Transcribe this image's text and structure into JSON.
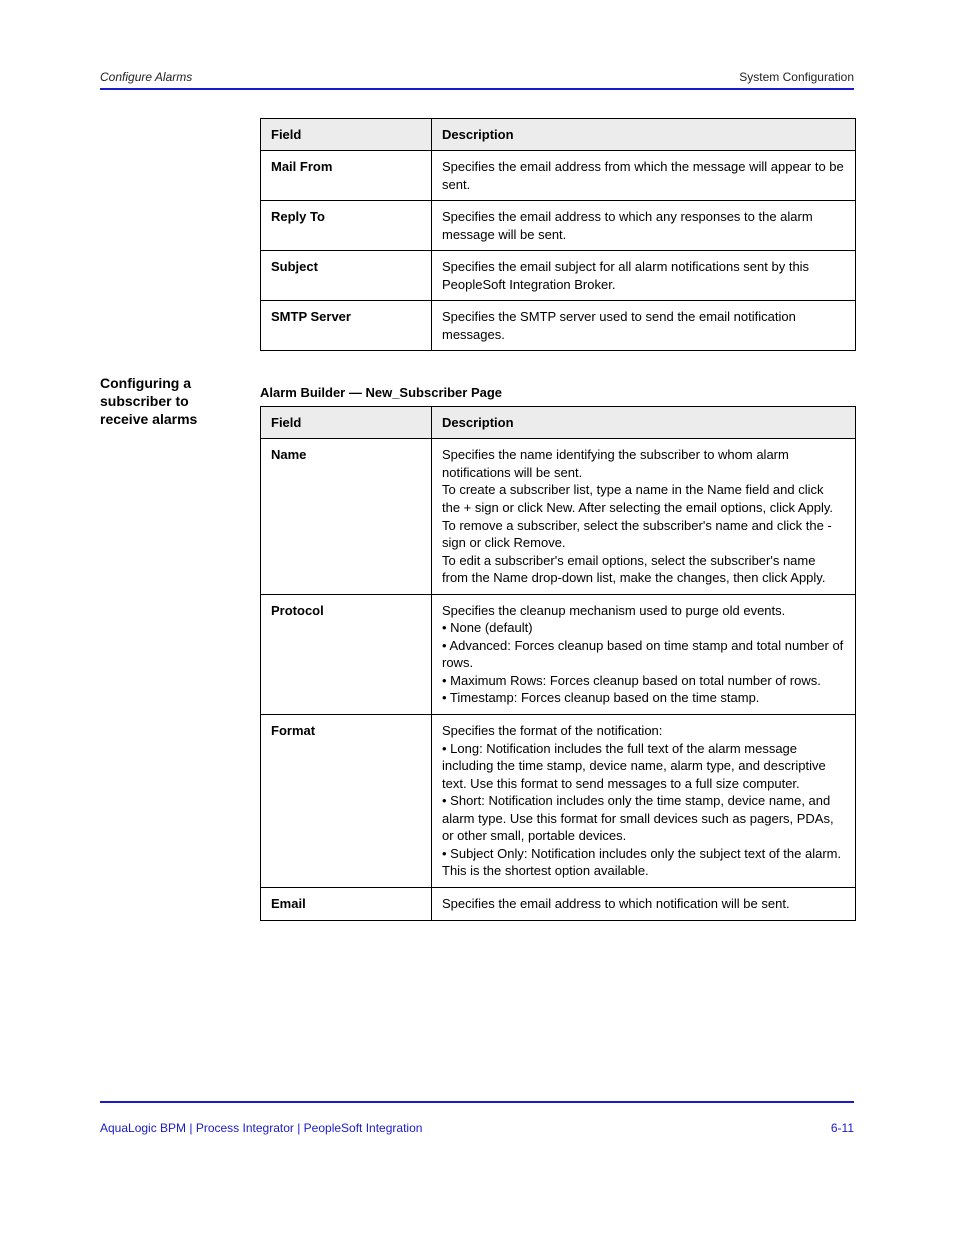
{
  "header": {
    "left": "Configure Alarms",
    "right": "System Configuration"
  },
  "table1": {
    "headers": [
      "Field",
      "Description"
    ],
    "rows": [
      [
        "Mail From",
        "Specifies the email address from which the message will appear to be sent."
      ],
      [
        "Reply To",
        "Specifies the email address to which any responses to the alarm message will be sent."
      ],
      [
        "Subject",
        "Specifies the email subject for all alarm notifications sent by this PeopleSoft Integration Broker."
      ],
      [
        "SMTP Server",
        "Specifies the SMTP server used to send the email notification messages."
      ]
    ]
  },
  "table2": {
    "caption": "Alarm Builder — New_Subscriber Page",
    "headers": [
      "Field",
      "Description"
    ],
    "rows": [
      [
        "Name",
        "Specifies the name identifying the subscriber to whom alarm notifications will be sent.\nTo create a subscriber list, type a name in the Name field and click the + sign or click New. After selecting the email options, click Apply.\nTo remove a subscriber, select the subscriber's name and click the - sign or click Remove.\nTo edit a subscriber's email options, select the subscriber's name from the Name drop-down list, make the changes, then click Apply."
      ],
      [
        "Protocol",
        "Specifies the cleanup mechanism used to purge old events.\n• None (default)\n• Advanced: Forces cleanup based on time stamp and total number of rows.\n• Maximum Rows: Forces cleanup based on total number of rows.\n• Timestamp: Forces cleanup based on the time stamp."
      ],
      [
        "Format",
        "Specifies the format of the notification:\n• Long: Notification includes the full text of the alarm message including the time stamp, device name, alarm type, and descriptive text. Use this format to send messages to a full size computer.\n• Short: Notification includes only the time stamp, device name, and alarm type. Use this format for small devices such as pagers, PDAs, or other small, portable devices.\n• Subject Only: Notification includes only the subject text of the alarm. This is the shortest option available."
      ],
      [
        "Email",
        "Specifies the email address to which notification will be sent."
      ]
    ]
  },
  "left_note": "Configuring a subscriber to receive alarms",
  "footer": {
    "left": "AquaLogic BPM | Process Integrator | PeopleSoft Integration",
    "right": "6-11"
  }
}
